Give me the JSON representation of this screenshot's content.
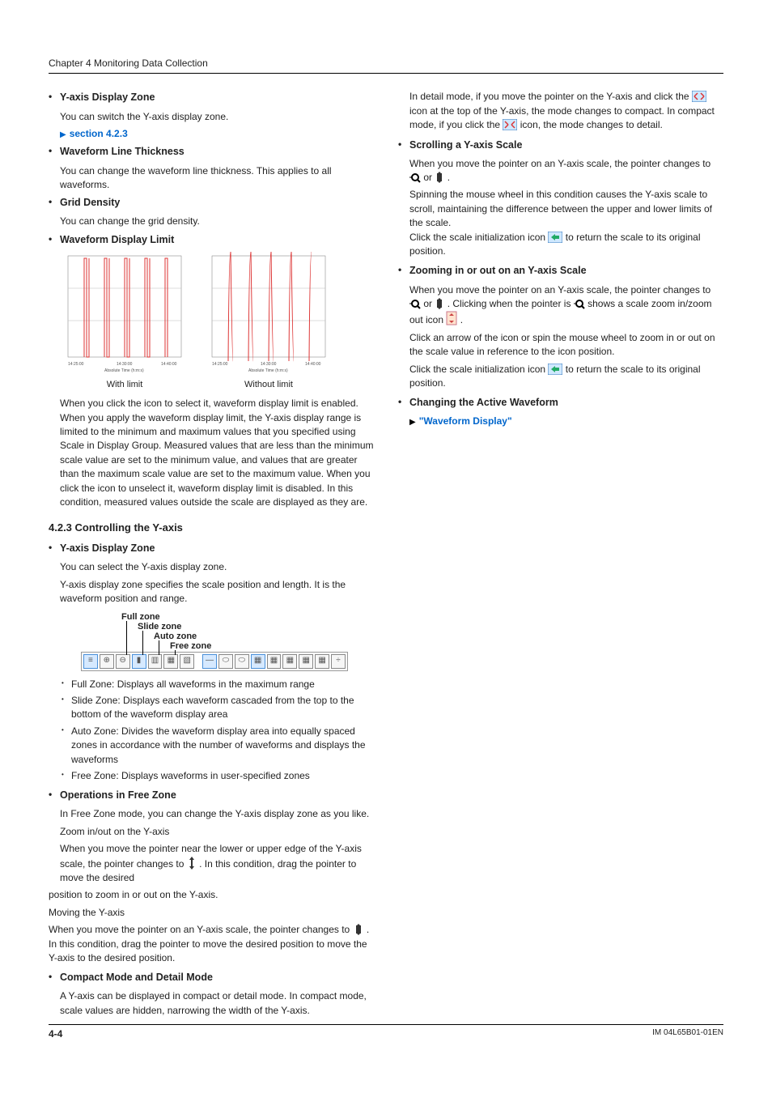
{
  "chapter": "Chapter 4  Monitoring Data Collection",
  "footer": {
    "page": "4-4",
    "doc": "IM 04L65B01-01EN"
  },
  "col1": {
    "yaxis_zone_h": "Y-axis Display Zone",
    "yaxis_zone_t": "You can switch the Y-axis display zone.",
    "yaxis_zone_link": "section 4.2.3",
    "thick_h": "Waveform Line Thickness",
    "thick_t": "You can change the waveform line thickness. This applies to all waveforms.",
    "grid_h": "Grid Density",
    "grid_t": "You can change the grid density.",
    "limit_h": "Waveform Display Limit",
    "limit_cap1": "With limit",
    "limit_cap2": "Without limit",
    "limit_t": "When you click the icon to select it, waveform display limit is enabled. When you apply the waveform display limit, the Y-axis display range is limited to the minimum and maximum values that you specified using Scale in Display Group. Measured values that are less than the minimum scale value are set to the minimum value, and values that are greater than the maximum scale value are set to the maximum value. When you click the icon to unselect it, waveform display limit is disabled. In this condition, measured values outside the scale are displayed as they are.",
    "sec423": "4.2.3  Controlling the Y-axis",
    "yzone2_h": "Y-axis Display Zone",
    "yzone2_t1": "You can select the Y-axis display zone.",
    "yzone2_t2": "Y-axis display zone specifies the scale position and length. It is the waveform position and range.",
    "zone_labels": {
      "full": "Full zone",
      "slide": "Slide zone",
      "auto": "Auto zone",
      "free": "Free zone"
    },
    "zones_full": "Full Zone: Displays all waveforms in the maximum range",
    "zones_slide": "Slide Zone: Displays each waveform cascaded from the top to the bottom of the waveform display area",
    "zones_auto": "Auto Zone: Divides the waveform display area into equally spaced zones in accordance with the number of waveforms and displays the waveforms",
    "zones_free": "Free Zone: Displays waveforms in user-specified zones",
    "ops_h": "Operations in Free Zone",
    "ops_t1": "In Free Zone mode, you can change the Y-axis display zone as you like.",
    "ops_t2": "Zoom in/out on the Y-axis",
    "ops_t3a": "When you move the pointer near the lower or upper edge of the Y-axis scale, the pointer changes to ",
    "ops_t3b": ". In this condition, drag the pointer to move the desired"
  },
  "col2": {
    "cont1": "position to zoom in or out on the Y-axis.",
    "cont2": "Moving the Y-axis",
    "cont3a": "When you move the pointer on an Y-axis scale, the pointer changes to ",
    "cont3b": ". In this condition, drag the pointer to move the desired position to move the Y-axis to the desired position.",
    "compact_h": "Compact Mode and Detail Mode",
    "compact_t1": "A Y-axis can be displayed in compact or detail mode. In compact mode, scale values are hidden, narrowing the width of the Y-axis.",
    "compact_t2a": "In detail mode, if you move the pointer on the Y-axis and click the ",
    "compact_t2b": " icon at the top of the Y-axis, the mode changes to compact. In compact mode, if you click the ",
    "compact_t2c": " icon, the mode changes to detail.",
    "scroll_h": "Scrolling a Y-axis Scale",
    "scroll_t1a": "When you move the pointer on an Y-axis scale, the pointer changes to ",
    "scroll_t1b": " or ",
    "scroll_t1c": ".",
    "scroll_t2a": "Spinning the mouse wheel in this condition causes the Y-axis scale to scroll, maintaining the difference between the upper and lower limits of the scale.",
    "scroll_t2b": "Click the scale initialization icon ",
    "scroll_t2c": " to return the scale to its original position.",
    "zoom_h": "Zooming in or out on an Y-axis Scale",
    "zoom_t1a": "When you move the pointer on an Y-axis scale, the pointer changes to ",
    "zoom_t1b": " or ",
    "zoom_t1c": ". Clicking when the pointer is ",
    "zoom_t1d": " shows a scale zoom in/zoom out icon ",
    "zoom_t1e": ".",
    "zoom_t2": "Click an arrow of the icon or spin the mouse wheel to zoom in or out on the scale value in reference to the icon position.",
    "zoom_t3a": "Click the scale initialization icon ",
    "zoom_t3b": " to return the scale to its original position.",
    "active_h": "Changing the Active Waveform",
    "active_link": "\"Waveform Display\""
  },
  "chart_data": [
    {
      "type": "line",
      "title": "With limit",
      "xlabel": "Absolute Time (h:m:s)",
      "x_ticks": [
        "14:25:00",
        "14:30:00",
        "14:40:00"
      ],
      "ylim": [
        0,
        20
      ],
      "description": "Five vertical waveforms clipped to min/max scale; tops and bottoms flatten at y-range boundaries."
    },
    {
      "type": "line",
      "title": "Without limit",
      "xlabel": "Absolute Time (h:m:s)",
      "x_ticks": [
        "14:25:00",
        "14:30:00",
        "14:40:00"
      ],
      "ylim": [
        0,
        20
      ],
      "description": "Five vertical waveforms extending beyond plotted y-range (no clipping)."
    }
  ]
}
